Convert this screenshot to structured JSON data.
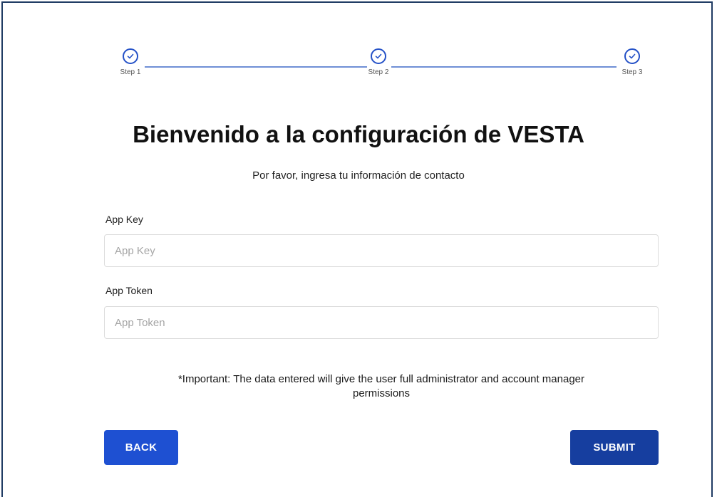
{
  "stepper": {
    "steps": [
      {
        "label": "Step 1",
        "status": "completed"
      },
      {
        "label": "Step 2",
        "status": "completed"
      },
      {
        "label": "Step 3",
        "status": "completed"
      }
    ]
  },
  "header": {
    "title": "Bienvenido a la configuración de VESTA",
    "subtitle": "Por favor, ingresa tu información de contacto"
  },
  "form": {
    "app_key": {
      "label": "App Key",
      "placeholder": "App Key",
      "value": ""
    },
    "app_token": {
      "label": "App Token",
      "placeholder": "App Token",
      "value": ""
    },
    "notice_line1": "*Important: The data entered will give the user full administrator and account manager",
    "notice_line2": "permissions"
  },
  "buttons": {
    "back_label": "BACK",
    "submit_label": "SUBMIT"
  },
  "colors": {
    "accent": "#1e50d2",
    "submit": "#163e9f",
    "step_line": "#6f8fd6",
    "frame_border": "#1f3b63"
  },
  "icons": {
    "step_check": "check-circle-icon"
  }
}
